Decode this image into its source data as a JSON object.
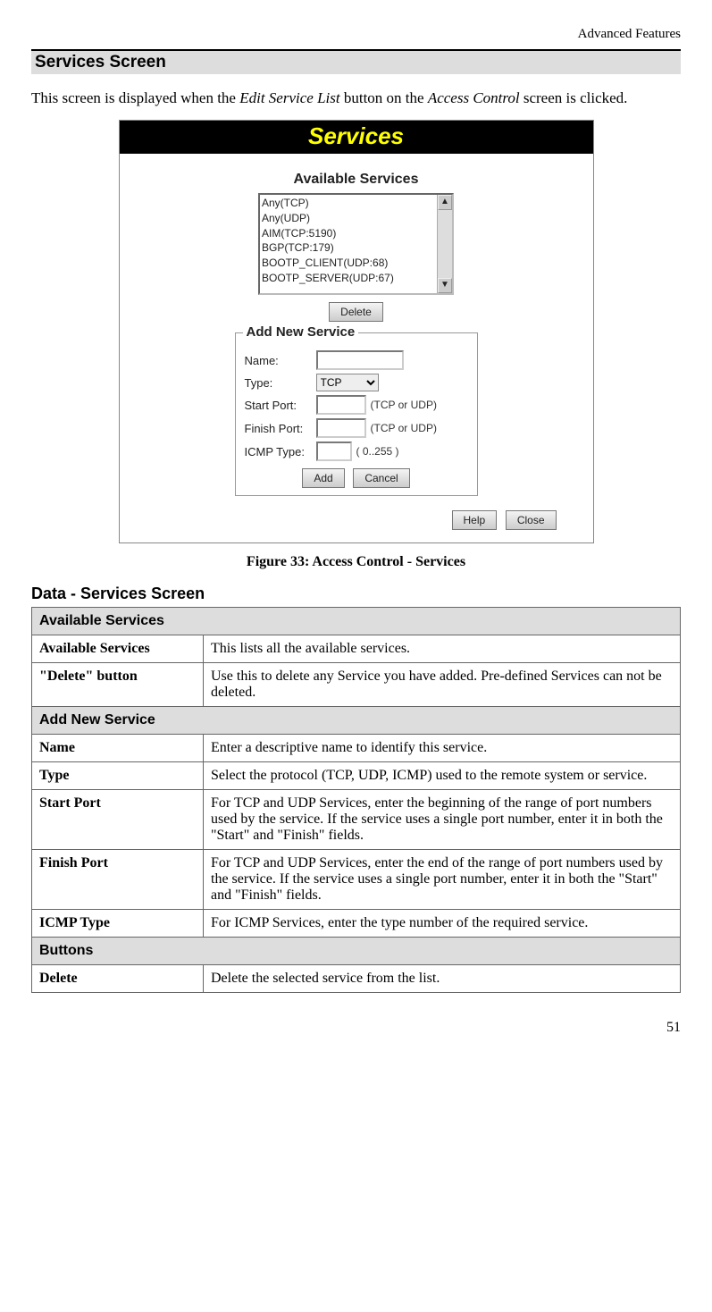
{
  "header_right": "Advanced Features",
  "section_title": "Services Screen",
  "intro_pre": "This screen is displayed when the ",
  "intro_em1": "Edit Service List",
  "intro_mid": " button on the ",
  "intro_em2": "Access Control",
  "intro_post": " screen is clicked.",
  "dialog": {
    "title": "Services",
    "available_heading": "Available Services",
    "services": [
      "Any(TCP)",
      "Any(UDP)",
      "AIM(TCP:5190)",
      "BGP(TCP:179)",
      "BOOTP_CLIENT(UDP:68)",
      "BOOTP_SERVER(UDP:67)"
    ],
    "delete_btn": "Delete",
    "add_heading": "Add New Service",
    "labels": {
      "name": "Name:",
      "type": "Type:",
      "start": "Start Port:",
      "finish": "Finish Port:",
      "icmp": "ICMP Type:"
    },
    "type_value": "TCP",
    "hint_port": "(TCP or UDP)",
    "hint_icmp": "( 0..255 )",
    "add_btn": "Add",
    "cancel_btn": "Cancel",
    "help_btn": "Help",
    "close_btn": "Close"
  },
  "caption": "Figure 33: Access Control - Services",
  "sub_title": "Data - Services Screen",
  "table": {
    "group1": "Available Services",
    "rows1": [
      {
        "label": "Available Services",
        "desc": "This lists all the available services."
      },
      {
        "label": "\"Delete\" button",
        "desc": "Use this to delete any Service you have added. Pre-defined Services can not be deleted."
      }
    ],
    "group2": "Add New Service",
    "rows2": [
      {
        "label": "Name",
        "desc": "Enter a descriptive name to identify this service."
      },
      {
        "label": "Type",
        "desc": "Select the protocol (TCP, UDP, ICMP) used to the remote system or service."
      },
      {
        "label": "Start Port",
        "desc": "For TCP and UDP Services, enter the beginning of the range of port numbers used by the service. If the service uses a single port number, enter it in both the \"Start\" and \"Finish\" fields."
      },
      {
        "label": "Finish Port",
        "desc": "For TCP and UDP Services, enter the end of the range of port numbers used by the service. If the service uses a single port number, enter it in both the \"Start\" and \"Finish\" fields."
      },
      {
        "label": "ICMP Type",
        "desc": "For ICMP Services, enter the type number of the required service."
      }
    ],
    "group3": "Buttons",
    "rows3": [
      {
        "label": "Delete",
        "desc": "Delete the selected service from the list."
      }
    ]
  },
  "pagenum": "51"
}
